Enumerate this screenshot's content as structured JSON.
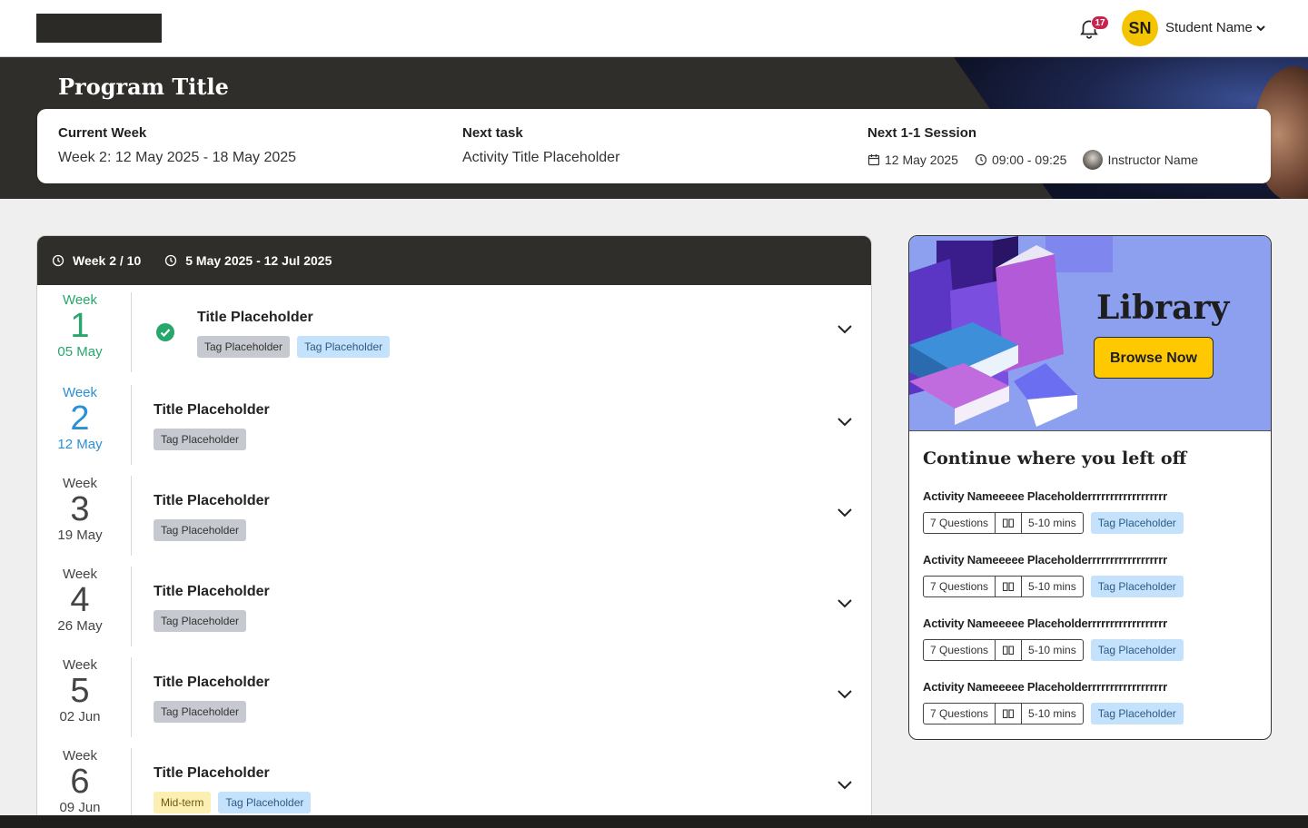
{
  "header": {
    "notification_count": "17",
    "user_initials": "SN",
    "user_name": "Student Name"
  },
  "hero": {
    "program_title": "Program Title",
    "current_week_label": "Current Week",
    "current_week_value": "Week 2: 12 May 2025 - 18 May 2025",
    "next_task_label": "Next task",
    "next_task_value": "Activity Title Placeholder",
    "next_session_label": "Next 1-1 Session",
    "session_date": "12 May 2025",
    "session_time": "09:00 - 09:25",
    "instructor_name": "Instructor Name"
  },
  "weeks": {
    "progress": "Week 2 / 10",
    "range": "5 May 2025 - 12 Jul 2025",
    "items": [
      {
        "word": "Week",
        "num": "1",
        "date": "05 May",
        "title": "Title Placeholder",
        "tags": [
          "Tag Placeholder",
          "Tag Placeholder"
        ]
      },
      {
        "word": "Week",
        "num": "2",
        "date": "12 May",
        "title": "Title Placeholder",
        "tags": [
          "Tag Placeholder"
        ]
      },
      {
        "word": "Week",
        "num": "3",
        "date": "19 May",
        "title": "Title Placeholder",
        "tags": [
          "Tag Placeholder"
        ]
      },
      {
        "word": "Week",
        "num": "4",
        "date": "26 May",
        "title": "Title Placeholder",
        "tags": [
          "Tag Placeholder"
        ]
      },
      {
        "word": "Week",
        "num": "5",
        "date": "02 Jun",
        "title": "Title Placeholder",
        "tags": [
          "Tag Placeholder"
        ]
      },
      {
        "word": "Week",
        "num": "6",
        "date": "09 Jun",
        "title": "Title Placeholder",
        "tags": [
          "Mid-term",
          "Tag Placeholder"
        ]
      }
    ]
  },
  "library": {
    "title": "Library",
    "browse_label": "Browse Now",
    "continue_title": "Continue where you left off",
    "activities": [
      {
        "name": "Activity Nameeeee Placeholderrrrrrrrrrrrrrrrrr",
        "questions": "7 Questions",
        "duration": "5-10 mins",
        "tag": "Tag Placeholder"
      },
      {
        "name": "Activity Nameeeee Placeholderrrrrrrrrrrrrrrrrr",
        "questions": "7 Questions",
        "duration": "5-10 mins",
        "tag": "Tag Placeholder"
      },
      {
        "name": "Activity Nameeeee Placeholderrrrrrrrrrrrrrrrrr",
        "questions": "7 Questions",
        "duration": "5-10 mins",
        "tag": "Tag Placeholder"
      },
      {
        "name": "Activity Nameeeee Placeholderrrrrrrrrrrrrrrrrr",
        "questions": "7 Questions",
        "duration": "5-10 mins",
        "tag": "Tag Placeholder"
      }
    ]
  },
  "colors": {
    "dark": "#302e2b",
    "accent_yellow": "#ffc800",
    "done_green": "#26a76b",
    "current_blue": "#2a8fd6",
    "badge_red": "#c8234d"
  },
  "icons": [
    "bell-icon",
    "chevron-down-icon",
    "calendar-icon",
    "clock-icon",
    "check-circle-icon",
    "book-icon"
  ]
}
